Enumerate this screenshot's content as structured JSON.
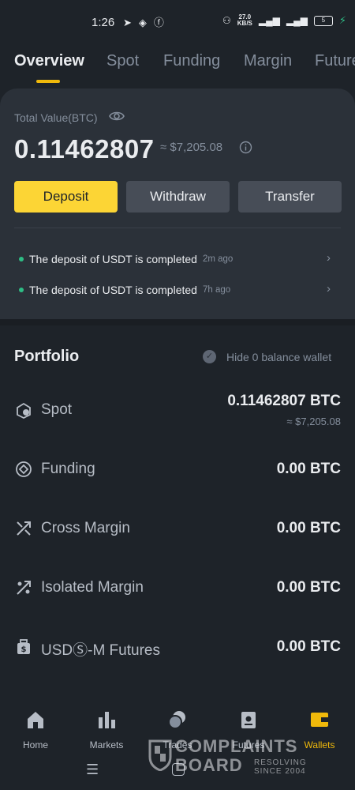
{
  "status_bar": {
    "time": "1:26",
    "speed_value": "27.0",
    "speed_unit": "KB/S",
    "battery": "5"
  },
  "tabs": [
    {
      "label": "Overview",
      "active": true
    },
    {
      "label": "Spot"
    },
    {
      "label": "Funding"
    },
    {
      "label": "Margin"
    },
    {
      "label": "Futures"
    }
  ],
  "overview": {
    "total_label": "Total Value(BTC)",
    "total_value": "0.11462807",
    "approx_value": "≈ $7,205.08",
    "buttons": {
      "deposit": "Deposit",
      "withdraw": "Withdraw",
      "transfer": "Transfer"
    },
    "notices": [
      {
        "message": "The deposit of USDT is completed",
        "ago": "2m ago"
      },
      {
        "message": "The deposit of USDT is completed",
        "ago": "7h ago"
      }
    ]
  },
  "portfolio": {
    "title": "Portfolio",
    "hide_label": "Hide 0 balance wallet",
    "rows": [
      {
        "label": "Spot",
        "value": "0.11462807 BTC",
        "sub": "≈ $7,205.08",
        "icon": "spot-icon"
      },
      {
        "label": "Funding",
        "value": "0.00 BTC",
        "icon": "funding-icon"
      },
      {
        "label": "Cross Margin",
        "value": "0.00 BTC",
        "icon": "cross-margin-icon"
      },
      {
        "label": "Isolated Margin",
        "value": "0.00 BTC",
        "icon": "isolated-margin-icon"
      },
      {
        "label": "USDⓈ-M Futures",
        "value": "0.00 BTC",
        "icon": "futures-icon"
      }
    ]
  },
  "bottom_nav": [
    {
      "label": "Home",
      "icon": "home-icon"
    },
    {
      "label": "Markets",
      "icon": "markets-icon"
    },
    {
      "label": "Trades",
      "icon": "trades-icon"
    },
    {
      "label": "Futures",
      "icon": "futures-nav-icon"
    },
    {
      "label": "Wallets",
      "icon": "wallet-icon",
      "active": true
    }
  ],
  "watermark": {
    "line1": "COMPLAINTS",
    "line2": "BOARD",
    "sub1": "RESOLVING",
    "sub2": "SINCE 2004"
  },
  "colors": {
    "background": "#1e2329",
    "card": "#2b3139",
    "accent": "#fcd535",
    "positive": "#2ebd85",
    "muted": "#848e9c"
  }
}
